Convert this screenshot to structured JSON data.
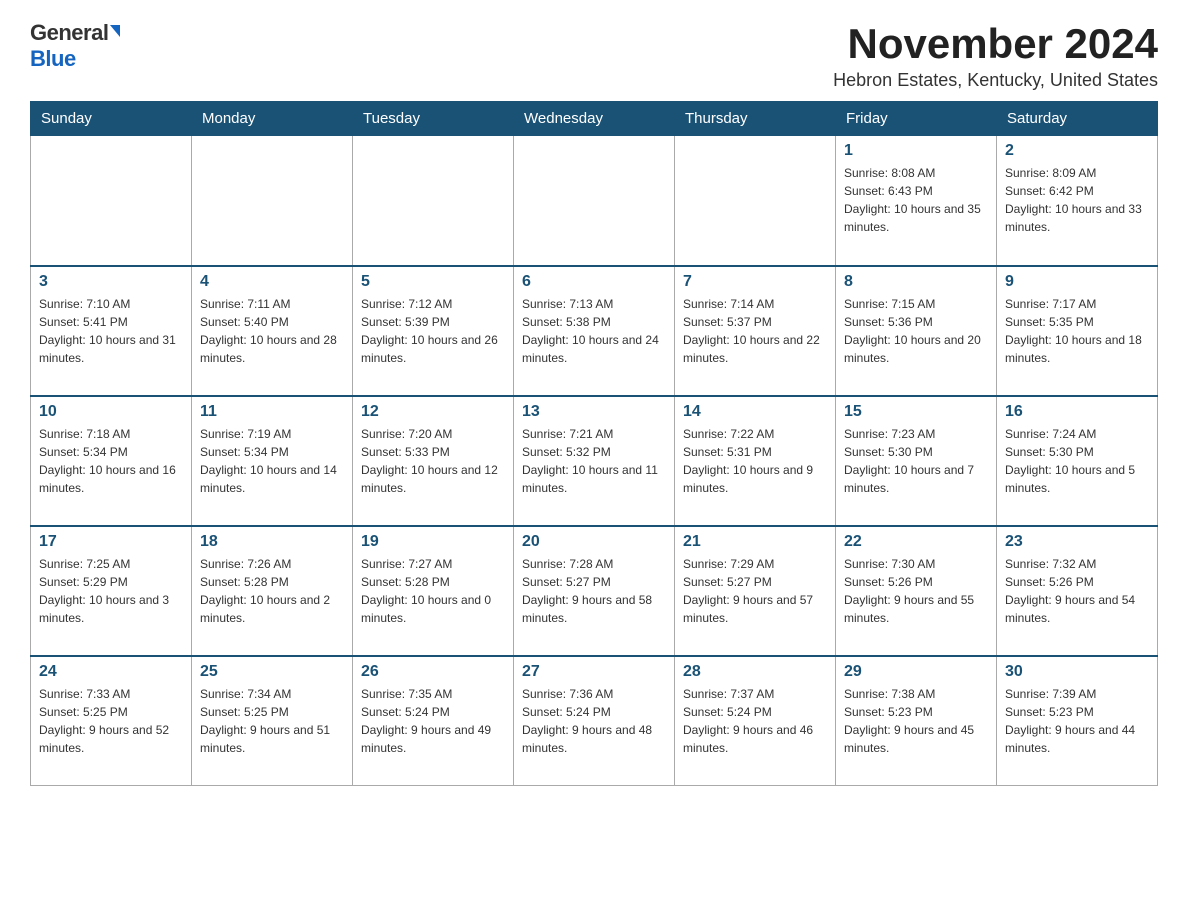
{
  "logo": {
    "general": "General",
    "blue": "Blue"
  },
  "title": "November 2024",
  "location": "Hebron Estates, Kentucky, United States",
  "days_of_week": [
    "Sunday",
    "Monday",
    "Tuesday",
    "Wednesday",
    "Thursday",
    "Friday",
    "Saturday"
  ],
  "weeks": [
    [
      {
        "day": "",
        "info": ""
      },
      {
        "day": "",
        "info": ""
      },
      {
        "day": "",
        "info": ""
      },
      {
        "day": "",
        "info": ""
      },
      {
        "day": "",
        "info": ""
      },
      {
        "day": "1",
        "info": "Sunrise: 8:08 AM\nSunset: 6:43 PM\nDaylight: 10 hours and 35 minutes."
      },
      {
        "day": "2",
        "info": "Sunrise: 8:09 AM\nSunset: 6:42 PM\nDaylight: 10 hours and 33 minutes."
      }
    ],
    [
      {
        "day": "3",
        "info": "Sunrise: 7:10 AM\nSunset: 5:41 PM\nDaylight: 10 hours and 31 minutes."
      },
      {
        "day": "4",
        "info": "Sunrise: 7:11 AM\nSunset: 5:40 PM\nDaylight: 10 hours and 28 minutes."
      },
      {
        "day": "5",
        "info": "Sunrise: 7:12 AM\nSunset: 5:39 PM\nDaylight: 10 hours and 26 minutes."
      },
      {
        "day": "6",
        "info": "Sunrise: 7:13 AM\nSunset: 5:38 PM\nDaylight: 10 hours and 24 minutes."
      },
      {
        "day": "7",
        "info": "Sunrise: 7:14 AM\nSunset: 5:37 PM\nDaylight: 10 hours and 22 minutes."
      },
      {
        "day": "8",
        "info": "Sunrise: 7:15 AM\nSunset: 5:36 PM\nDaylight: 10 hours and 20 minutes."
      },
      {
        "day": "9",
        "info": "Sunrise: 7:17 AM\nSunset: 5:35 PM\nDaylight: 10 hours and 18 minutes."
      }
    ],
    [
      {
        "day": "10",
        "info": "Sunrise: 7:18 AM\nSunset: 5:34 PM\nDaylight: 10 hours and 16 minutes."
      },
      {
        "day": "11",
        "info": "Sunrise: 7:19 AM\nSunset: 5:34 PM\nDaylight: 10 hours and 14 minutes."
      },
      {
        "day": "12",
        "info": "Sunrise: 7:20 AM\nSunset: 5:33 PM\nDaylight: 10 hours and 12 minutes."
      },
      {
        "day": "13",
        "info": "Sunrise: 7:21 AM\nSunset: 5:32 PM\nDaylight: 10 hours and 11 minutes."
      },
      {
        "day": "14",
        "info": "Sunrise: 7:22 AM\nSunset: 5:31 PM\nDaylight: 10 hours and 9 minutes."
      },
      {
        "day": "15",
        "info": "Sunrise: 7:23 AM\nSunset: 5:30 PM\nDaylight: 10 hours and 7 minutes."
      },
      {
        "day": "16",
        "info": "Sunrise: 7:24 AM\nSunset: 5:30 PM\nDaylight: 10 hours and 5 minutes."
      }
    ],
    [
      {
        "day": "17",
        "info": "Sunrise: 7:25 AM\nSunset: 5:29 PM\nDaylight: 10 hours and 3 minutes."
      },
      {
        "day": "18",
        "info": "Sunrise: 7:26 AM\nSunset: 5:28 PM\nDaylight: 10 hours and 2 minutes."
      },
      {
        "day": "19",
        "info": "Sunrise: 7:27 AM\nSunset: 5:28 PM\nDaylight: 10 hours and 0 minutes."
      },
      {
        "day": "20",
        "info": "Sunrise: 7:28 AM\nSunset: 5:27 PM\nDaylight: 9 hours and 58 minutes."
      },
      {
        "day": "21",
        "info": "Sunrise: 7:29 AM\nSunset: 5:27 PM\nDaylight: 9 hours and 57 minutes."
      },
      {
        "day": "22",
        "info": "Sunrise: 7:30 AM\nSunset: 5:26 PM\nDaylight: 9 hours and 55 minutes."
      },
      {
        "day": "23",
        "info": "Sunrise: 7:32 AM\nSunset: 5:26 PM\nDaylight: 9 hours and 54 minutes."
      }
    ],
    [
      {
        "day": "24",
        "info": "Sunrise: 7:33 AM\nSunset: 5:25 PM\nDaylight: 9 hours and 52 minutes."
      },
      {
        "day": "25",
        "info": "Sunrise: 7:34 AM\nSunset: 5:25 PM\nDaylight: 9 hours and 51 minutes."
      },
      {
        "day": "26",
        "info": "Sunrise: 7:35 AM\nSunset: 5:24 PM\nDaylight: 9 hours and 49 minutes."
      },
      {
        "day": "27",
        "info": "Sunrise: 7:36 AM\nSunset: 5:24 PM\nDaylight: 9 hours and 48 minutes."
      },
      {
        "day": "28",
        "info": "Sunrise: 7:37 AM\nSunset: 5:24 PM\nDaylight: 9 hours and 46 minutes."
      },
      {
        "day": "29",
        "info": "Sunrise: 7:38 AM\nSunset: 5:23 PM\nDaylight: 9 hours and 45 minutes."
      },
      {
        "day": "30",
        "info": "Sunrise: 7:39 AM\nSunset: 5:23 PM\nDaylight: 9 hours and 44 minutes."
      }
    ]
  ]
}
